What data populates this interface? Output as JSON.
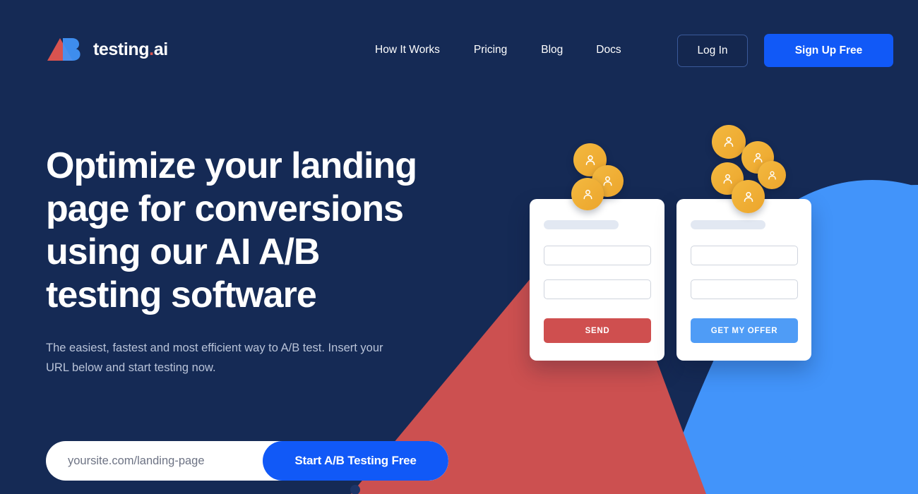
{
  "brand": {
    "name": "testing",
    "suffix_dot": ".",
    "suffix": "ai",
    "logo_icon_a": "triangle-a-icon",
    "logo_icon_b": "rounded-b-icon",
    "colors": {
      "navy": "#152a55",
      "red": "#cc5050",
      "light_blue": "#4294fa",
      "cta_blue": "#1159f7",
      "amber": "#eeae38"
    }
  },
  "nav": {
    "items": [
      {
        "label": "How It Works"
      },
      {
        "label": "Pricing"
      },
      {
        "label": "Blog"
      },
      {
        "label": "Docs"
      }
    ],
    "login_label": "Log In",
    "signup_label": "Sign Up Free"
  },
  "hero": {
    "title": "Optimize your landing page for conversions using our AI A/B testing software",
    "subtitle": "The easiest, fastest and most efficient way to A/B test. Insert your URL below and start testing now."
  },
  "cta": {
    "input_value": "",
    "input_placeholder": "yoursite.com/landing-page",
    "button_label": "Start A/B Testing Free"
  },
  "variants": {
    "a": {
      "button_label": "SEND",
      "button_color": "#cf4f4f",
      "field_1_value": "",
      "field_2_value": "",
      "avatar_count": 3
    },
    "b": {
      "button_label": "GET MY OFFER",
      "button_color": "#4f9cf6",
      "field_1_value": "",
      "field_2_value": "",
      "avatar_count": 5
    }
  }
}
